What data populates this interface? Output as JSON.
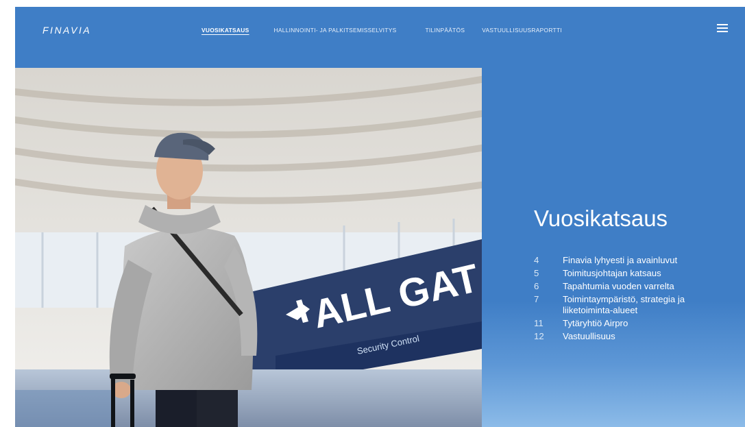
{
  "header": {
    "logo": "FINAVIA",
    "nav": [
      {
        "label": "VUOSIKATSAUS",
        "active": true
      },
      {
        "label": "HALLINNOINTI- JA PALKITSEMISSELVITYS",
        "active": false
      },
      {
        "label": "TILINPÄÄTÖS",
        "active": false
      },
      {
        "label": "VASTUULLISUUSRAPORTTI",
        "active": false
      }
    ],
    "menu_icon": "hamburger-menu-icon"
  },
  "hero": {
    "sign_text": "ALL GAT",
    "sub_sign_text": "Security Control",
    "icon": "airplane-icon"
  },
  "section": {
    "title": "Vuosikatsaus",
    "toc": [
      {
        "page": "4",
        "label": "Finavia lyhyesti ja avainluvut"
      },
      {
        "page": "5",
        "label": "Toimitusjohtajan katsaus"
      },
      {
        "page": "6",
        "label": "Tapahtumia vuoden varrelta"
      },
      {
        "page": "7",
        "label": "Toimintaympäristö, strategia ja liiketoiminta-alueet"
      },
      {
        "page": "11",
        "label": "Tytäryhtiö Airpro"
      },
      {
        "page": "12",
        "label": "Vastuullisuus"
      }
    ]
  },
  "colors": {
    "background": "#3f7ec6",
    "text": "#ffffff"
  }
}
